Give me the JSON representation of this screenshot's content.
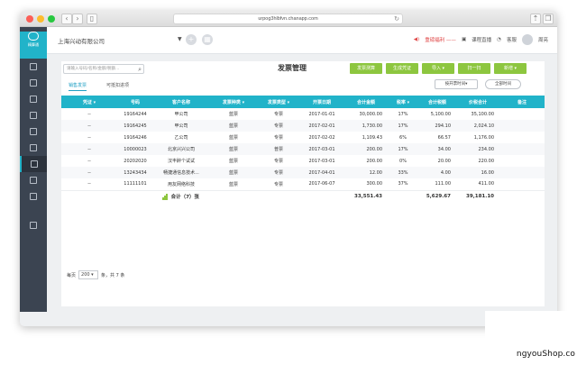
{
  "browser": {
    "url": "urpog3hlbfvn.chanapp.com"
  },
  "sidebar": {
    "brand": "精算通",
    "items": [
      {
        "icon": "ledger-icon"
      },
      {
        "icon": "voucher-icon"
      },
      {
        "icon": "chart-icon"
      },
      {
        "icon": "report-icon"
      },
      {
        "icon": "asset-icon"
      },
      {
        "icon": "invoice-icon"
      },
      {
        "icon": "invoice-active-icon"
      },
      {
        "icon": "tax-icon"
      },
      {
        "icon": "settings-icon"
      },
      {
        "icon": "logout-icon"
      }
    ]
  },
  "topbar": {
    "company": "上海兴动有限公司",
    "alert": "重磅福利 ——",
    "live": "课程直播",
    "message": "客服",
    "user": "周亮"
  },
  "page": {
    "search_placeholder": "请输入号码/名称/金额/税额...",
    "title": "发票管理",
    "buttons": {
      "scan": "发票测算",
      "create": "生成凭证",
      "import": "导入 ▾",
      "sweep": "扫一扫",
      "add": "新增 ▾"
    },
    "tabs": {
      "sales": "销售发票",
      "cert": "可抵扣进项"
    },
    "sort_button": "按开票时间▾",
    "time_button": "全部时间"
  },
  "table": {
    "headers": {
      "voucher": "凭证 ▾",
      "number": "号码",
      "customer": "客户名称",
      "kind": "发票种类 ▾",
      "type": "发票类型 ▾",
      "date": "开票日期",
      "amount": "合计金额",
      "rate": "税率 ▾",
      "tax": "合计税额",
      "total": "价税合计",
      "note": "备注"
    },
    "rows": [
      {
        "voucher": "--",
        "number": "19164244",
        "customer": "甲公司",
        "kind": "蓝票",
        "type": "专票",
        "date": "2017-01-01",
        "amount": "30,000.00",
        "rate": "17%",
        "tax": "5,100.00",
        "total": "35,100.00"
      },
      {
        "voucher": "--",
        "number": "19164245",
        "customer": "甲公司",
        "kind": "蓝票",
        "type": "专票",
        "date": "2017-02-01",
        "amount": "1,730.00",
        "rate": "17%",
        "tax": "294.10",
        "total": "2,024.10"
      },
      {
        "voucher": "--",
        "number": "19164246",
        "customer": "乙公司",
        "kind": "蓝票",
        "type": "专票",
        "date": "2017-02-02",
        "amount": "1,109.43",
        "rate": "6%",
        "tax": "66.57",
        "total": "1,176.00"
      },
      {
        "voucher": "--",
        "number": "10000023",
        "customer": "北京兴兴公司",
        "kind": "蓝票",
        "type": "普票",
        "date": "2017-03-01",
        "amount": "200.00",
        "rate": "17%",
        "tax": "34.00",
        "total": "234.00"
      },
      {
        "voucher": "--",
        "number": "20202020",
        "customer": "汉丰醉个试试",
        "kind": "蓝票",
        "type": "专票",
        "date": "2017-03-01",
        "amount": "200.00",
        "rate": "0%",
        "tax": "20.00",
        "total": "220.00"
      },
      {
        "voucher": "--",
        "number": "13243434",
        "customer": "畅捷通信息技术...",
        "kind": "蓝票",
        "type": "专票",
        "date": "2017-04-01",
        "amount": "12.00",
        "rate": "33%",
        "tax": "4.00",
        "total": "16.00"
      },
      {
        "voucher": "--",
        "number": "11111101",
        "customer": "用友网络科技",
        "kind": "蓝票",
        "type": "专票",
        "date": "2017-06-07",
        "amount": "300.00",
        "rate": "37%",
        "tax": "111.00",
        "total": "411.00"
      }
    ],
    "summary": {
      "label": "合计（7）张",
      "amount": "33,551.43",
      "tax": "5,629.67",
      "total": "39,181.10"
    }
  },
  "pager": {
    "prefix": "每页",
    "size": "200",
    "suffix": "条，共 7 条"
  },
  "watermark": "ngyouShop.co"
}
